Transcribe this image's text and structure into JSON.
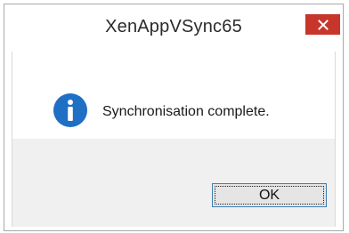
{
  "window": {
    "title": "XenAppVSync65",
    "close_icon": "close-icon",
    "close_color": "#c7352b"
  },
  "dialog": {
    "icon": "info-icon",
    "icon_color": "#1f6fc5",
    "message": "Synchronisation complete.",
    "ok_label": "OK"
  }
}
